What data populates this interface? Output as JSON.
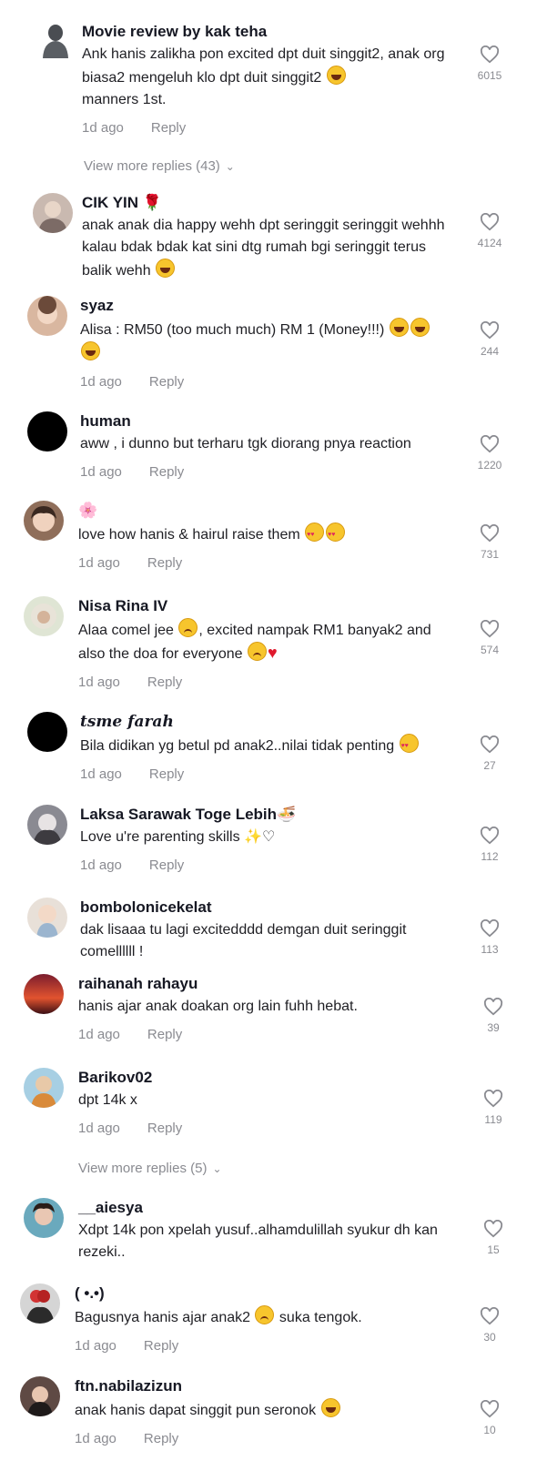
{
  "comments": [
    {
      "username": "Movie review by kak teha",
      "text": "Ank hanis zalikha pon excited dpt duit singgit2, anak org biasa2 mengeluh klo dpt duit singgit2",
      "text_tail": "manners 1st.",
      "emoji": "laugh",
      "age": "1d ago",
      "reply": "Reply",
      "likes": "6015",
      "avatar_color": "#555a60"
    },
    {
      "username": "CIK YIN",
      "username_emoji": "🌹",
      "text": "anak anak dia happy wehh dpt seringgit seringgit wehhh kalau bdak bdak kat sini dtg rumah bgi seringgit terus balik wehh",
      "emoji": "laugh",
      "age": "",
      "reply": "",
      "likes": "4124",
      "avatar_color": "#b0a29a"
    },
    {
      "username": "syaz",
      "text": "Alisa : RM50 (too much much) RM 1 (Money!!!)",
      "emoji": "laugh3",
      "age": "1d ago",
      "reply": "Reply",
      "likes": "244",
      "avatar_color": "#c9a08a"
    },
    {
      "username": "human",
      "text": "aww , i dunno but terharu tgk diorang pnya reaction",
      "age": "1d ago",
      "reply": "Reply",
      "likes": "1220",
      "avatar_color": "#000000"
    },
    {
      "username": "🌸",
      "text": "love how hanis & hairul raise them",
      "emoji": "love2",
      "age": "1d ago",
      "reply": "Reply",
      "likes": "731",
      "avatar_color": "#9b7b66"
    },
    {
      "username": "Nisa Rina IV",
      "text": "Alaa comel jee",
      "text_mid": ", excited nampak RM1 banyak2 and also the doa for everyone",
      "emoji": "sadheart",
      "age": "1d ago",
      "reply": "Reply",
      "likes": "574",
      "avatar_color": "#a8b39a"
    },
    {
      "username": "tsme farah",
      "text": "Bila didikan yg betul pd anak2..nilai tidak penting",
      "emoji": "love",
      "age": "1d ago",
      "reply": "Reply",
      "likes": "27",
      "avatar_color": "#000000"
    },
    {
      "username": "Laksa Sarawak Toge Lebih",
      "username_emoji": "🍜",
      "text": "Love u're parenting skills ✨♡",
      "age": "1d ago",
      "reply": "Reply",
      "likes": "112",
      "avatar_color": "#6d6d75"
    },
    {
      "username": "bombolonicekelat",
      "text": "dak lisaaa tu lagi excitedddd demgan duit seringgit comellllll !",
      "age": "",
      "reply": "",
      "likes": "113",
      "avatar_color": "#c4b8ad"
    },
    {
      "username": "raihanah rahayu",
      "text": "hanis ajar anak doakan org lain fuhh hebat.",
      "age": "1d ago",
      "reply": "Reply",
      "likes": "39",
      "avatar_color": "#c4422c"
    },
    {
      "username": "Barikov02",
      "text": "dpt 14k x",
      "age": "1d ago",
      "reply": "Reply",
      "likes": "119",
      "avatar_color": "#6fa6c4"
    },
    {
      "username": "__aiesya",
      "text": "Xdpt 14k pon xpelah yusuf..alhamdulillah syukur dh kan rezeki..",
      "age": "",
      "reply": "",
      "likes": "15",
      "avatar_color": "#5a9cb0"
    },
    {
      "username": "( •.•)",
      "text": "Bagusnya hanis ajar anak2",
      "text_mid": " suka tengok.",
      "emoji": "sadmid",
      "age": "1d ago",
      "reply": "Reply",
      "likes": "30",
      "avatar_color": "#3a3a3a"
    },
    {
      "username": "ftn.nabilazizun",
      "text": "anak hanis dapat singgit pun seronok",
      "emoji": "laugh",
      "age": "1d ago",
      "reply": "Reply",
      "likes": "10",
      "avatar_color": "#7a5a50"
    }
  ],
  "view_more_1": "View more replies (43)",
  "view_more_2": "View more replies (5)",
  "colors": {
    "muted": "#8a8b91",
    "text": "#161823"
  },
  "icons": {
    "like": "heart-outline-icon",
    "chevron": "chevron-down-icon"
  }
}
